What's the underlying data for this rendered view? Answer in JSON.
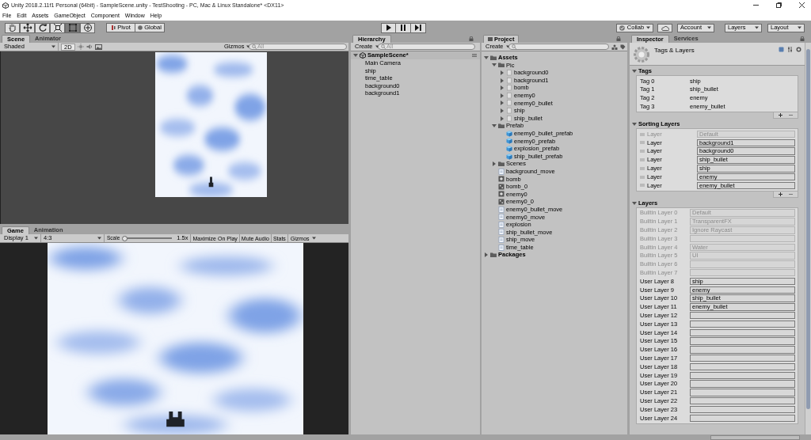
{
  "window": {
    "title": "Unity 2018.2.11f1 Personal (64bit) - SampleScene.unity - TestShooting - PC, Mac & Linux Standalone* <DX11>"
  },
  "menu": [
    "File",
    "Edit",
    "Assets",
    "GameObject",
    "Component",
    "Window",
    "Help"
  ],
  "toolbar": {
    "tools": [
      {
        "kind": "hand",
        "selected": false
      },
      {
        "kind": "move",
        "selected": false
      },
      {
        "kind": "rotate",
        "selected": false
      },
      {
        "kind": "scale",
        "selected": false
      },
      {
        "kind": "rect",
        "selected": true
      },
      {
        "kind": "transform",
        "selected": false
      }
    ],
    "pivot": "Pivot",
    "global": "Global",
    "play_controls": [
      {
        "kind": "play"
      },
      {
        "kind": "pause"
      },
      {
        "kind": "step"
      }
    ],
    "collab": "Collab",
    "account": "Account",
    "layers": "Layers",
    "layout": "Layout"
  },
  "scene_panel": {
    "tabs": [
      {
        "label": "Scene",
        "selected": true
      },
      {
        "label": "Animator",
        "selected": false
      }
    ],
    "shading": "Shaded",
    "mode": "2D",
    "gizmos": "Gizmos",
    "search": {
      "placeholder": "All"
    }
  },
  "game_panel": {
    "tabs": [
      {
        "label": "Game",
        "selected": true
      },
      {
        "label": "Animation",
        "selected": false
      }
    ],
    "display": "Display 1",
    "aspect": "4:3",
    "scale": {
      "label": "Scale",
      "level": 0.03,
      "reading": "1.5x"
    },
    "buttons": [
      "Maximize On Play",
      "Mute Audio",
      "Stats"
    ],
    "gizmos": "Gizmos"
  },
  "hierarchy": {
    "tab": "Hierarchy",
    "create": "Create",
    "search": {
      "placeholder": "All"
    },
    "scene": {
      "label": "SampleScene*",
      "expanded": true,
      "children": [
        {
          "label": "Main Camera"
        },
        {
          "label": "ship"
        },
        {
          "label": "time_table"
        },
        {
          "label": "background0"
        },
        {
          "label": "background1"
        }
      ]
    }
  },
  "project": {
    "tab": "Project",
    "create": "Create",
    "tree": [
      {
        "label": "Assets",
        "kind": "folder",
        "expanded": true,
        "children": [
          {
            "label": "Pic",
            "kind": "folder",
            "expanded": true,
            "children": [
              {
                "label": "background0",
                "kind": "sprite",
                "expanded": false
              },
              {
                "label": "background1",
                "kind": "sprite",
                "expanded": false
              },
              {
                "label": "bomb",
                "kind": "sprite",
                "expanded": false
              },
              {
                "label": "enemy0",
                "kind": "sprite",
                "expanded": false
              },
              {
                "label": "enemy0_bullet",
                "kind": "sprite",
                "expanded": false
              },
              {
                "label": "ship",
                "kind": "sprite",
                "expanded": false
              },
              {
                "label": "ship_bullet",
                "kind": "sprite",
                "expanded": false
              }
            ]
          },
          {
            "label": "Prefab",
            "kind": "folder",
            "expanded": true,
            "children": [
              {
                "label": "enemy0_bullet_prefab",
                "kind": "prefab"
              },
              {
                "label": "enemy0_prefab",
                "kind": "prefab"
              },
              {
                "label": "explosion_prefab",
                "kind": "prefab"
              },
              {
                "label": "ship_bullet_prefab",
                "kind": "prefab"
              }
            ]
          },
          {
            "label": "Scenes",
            "kind": "folder",
            "expanded": false
          },
          {
            "label": "background_move",
            "kind": "script"
          },
          {
            "label": "bomb",
            "kind": "controller"
          },
          {
            "label": "bomb_0",
            "kind": "animation"
          },
          {
            "label": "enemy0",
            "kind": "controller"
          },
          {
            "label": "enemy0_0",
            "kind": "animation"
          },
          {
            "label": "enemy0_bullet_move",
            "kind": "script"
          },
          {
            "label": "enemy0_move",
            "kind": "script"
          },
          {
            "label": "explosion",
            "kind": "script"
          },
          {
            "label": "ship_bullet_move",
            "kind": "script"
          },
          {
            "label": "ship_move",
            "kind": "script"
          },
          {
            "label": "time_table",
            "kind": "script"
          }
        ]
      },
      {
        "label": "Packages",
        "kind": "folder",
        "expanded": false
      }
    ]
  },
  "inspector": {
    "tabs": [
      {
        "label": "Inspector",
        "selected": true
      },
      {
        "label": "Services",
        "selected": false
      }
    ],
    "title": "Tags & Layers",
    "sections": [
      {
        "title": "Tags",
        "kind": "tags",
        "expanded": true,
        "rows": [
          {
            "label": "Tag 0",
            "value": "ship"
          },
          {
            "label": "Tag 1",
            "value": "ship_bullet"
          },
          {
            "label": "Tag 2",
            "value": "enemy"
          },
          {
            "label": "Tag 3",
            "value": "enemy_bullet"
          }
        ]
      },
      {
        "title": "Sorting Layers",
        "kind": "sorting",
        "expanded": true,
        "rows": [
          {
            "label": "Layer",
            "value": "Default",
            "disabled": true
          },
          {
            "label": "Layer",
            "value": "background1",
            "disabled": false
          },
          {
            "label": "Layer",
            "value": "background0",
            "disabled": false
          },
          {
            "label": "Layer",
            "value": "ship_bullet",
            "disabled": false
          },
          {
            "label": "Layer",
            "value": "ship",
            "disabled": false
          },
          {
            "label": "Layer",
            "value": "enemy",
            "disabled": false
          },
          {
            "label": "Layer",
            "value": "enemy_bullet",
            "disabled": false
          }
        ]
      },
      {
        "title": "Layers",
        "kind": "layers",
        "expanded": true,
        "rows": [
          {
            "label": "Builtin Layer 0",
            "value": "Default",
            "disabled": true
          },
          {
            "label": "Builtin Layer 1",
            "value": "TransparentFX",
            "disabled": true
          },
          {
            "label": "Builtin Layer 2",
            "value": "Ignore Raycast",
            "disabled": true
          },
          {
            "label": "Builtin Layer 3",
            "disabled": true
          },
          {
            "label": "Builtin Layer 4",
            "value": "Water",
            "disabled": true
          },
          {
            "label": "Builtin Layer 5",
            "value": "UI",
            "disabled": true
          },
          {
            "label": "Builtin Layer 6",
            "disabled": true
          },
          {
            "label": "Builtin Layer 7",
            "disabled": true
          },
          {
            "label": "User Layer 8",
            "value": "ship",
            "disabled": false
          },
          {
            "label": "User Layer 9",
            "value": "enemy",
            "disabled": false
          },
          {
            "label": "User Layer 10",
            "value": "ship_bullet",
            "disabled": false
          },
          {
            "label": "User Layer 11",
            "value": "enemy_bullet",
            "disabled": false
          },
          {
            "label": "User Layer 12",
            "disabled": false
          },
          {
            "label": "User Layer 13",
            "disabled": false
          },
          {
            "label": "User Layer 14",
            "disabled": false
          },
          {
            "label": "User Layer 15",
            "disabled": false
          },
          {
            "label": "User Layer 16",
            "disabled": false
          },
          {
            "label": "User Layer 17",
            "disabled": false
          },
          {
            "label": "User Layer 18",
            "disabled": false
          },
          {
            "label": "User Layer 19",
            "disabled": false
          },
          {
            "label": "User Layer 20",
            "disabled": false
          },
          {
            "label": "User Layer 21",
            "disabled": false
          },
          {
            "label": "User Layer 22",
            "disabled": false
          },
          {
            "label": "User Layer 23",
            "disabled": false
          },
          {
            "label": "User Layer 24",
            "disabled": false
          }
        ]
      }
    ]
  }
}
